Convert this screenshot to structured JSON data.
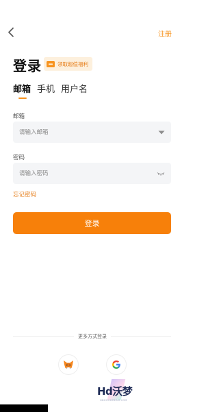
{
  "header": {
    "back_icon": "chevron-left-icon",
    "register_label": "注册"
  },
  "title": "登录",
  "bonus_badge": {
    "icon": "ticket-icon",
    "label": "领取超值福利"
  },
  "tabs": [
    {
      "label": "邮箱",
      "active": true
    },
    {
      "label": "手机",
      "active": false
    },
    {
      "label": "用户名",
      "active": false
    }
  ],
  "email": {
    "label": "邮箱",
    "placeholder": "请输入邮箱",
    "value": ""
  },
  "password": {
    "label": "密码",
    "placeholder": "请输入密码",
    "value": ""
  },
  "forgot_label": "忘记密码",
  "login_label": "登录",
  "more_label": "更多方式登录",
  "social": [
    {
      "icon": "metamask-icon"
    },
    {
      "icon": "google-icon"
    }
  ],
  "watermark": {
    "logo": "Hd沃梦",
    "sub": "HDHOODREAM.COM"
  },
  "colors": {
    "accent": "#f7931e",
    "button": "#f7800a",
    "field_bg": "#f4f5f7",
    "badge_bg": "#fdf0dd"
  }
}
